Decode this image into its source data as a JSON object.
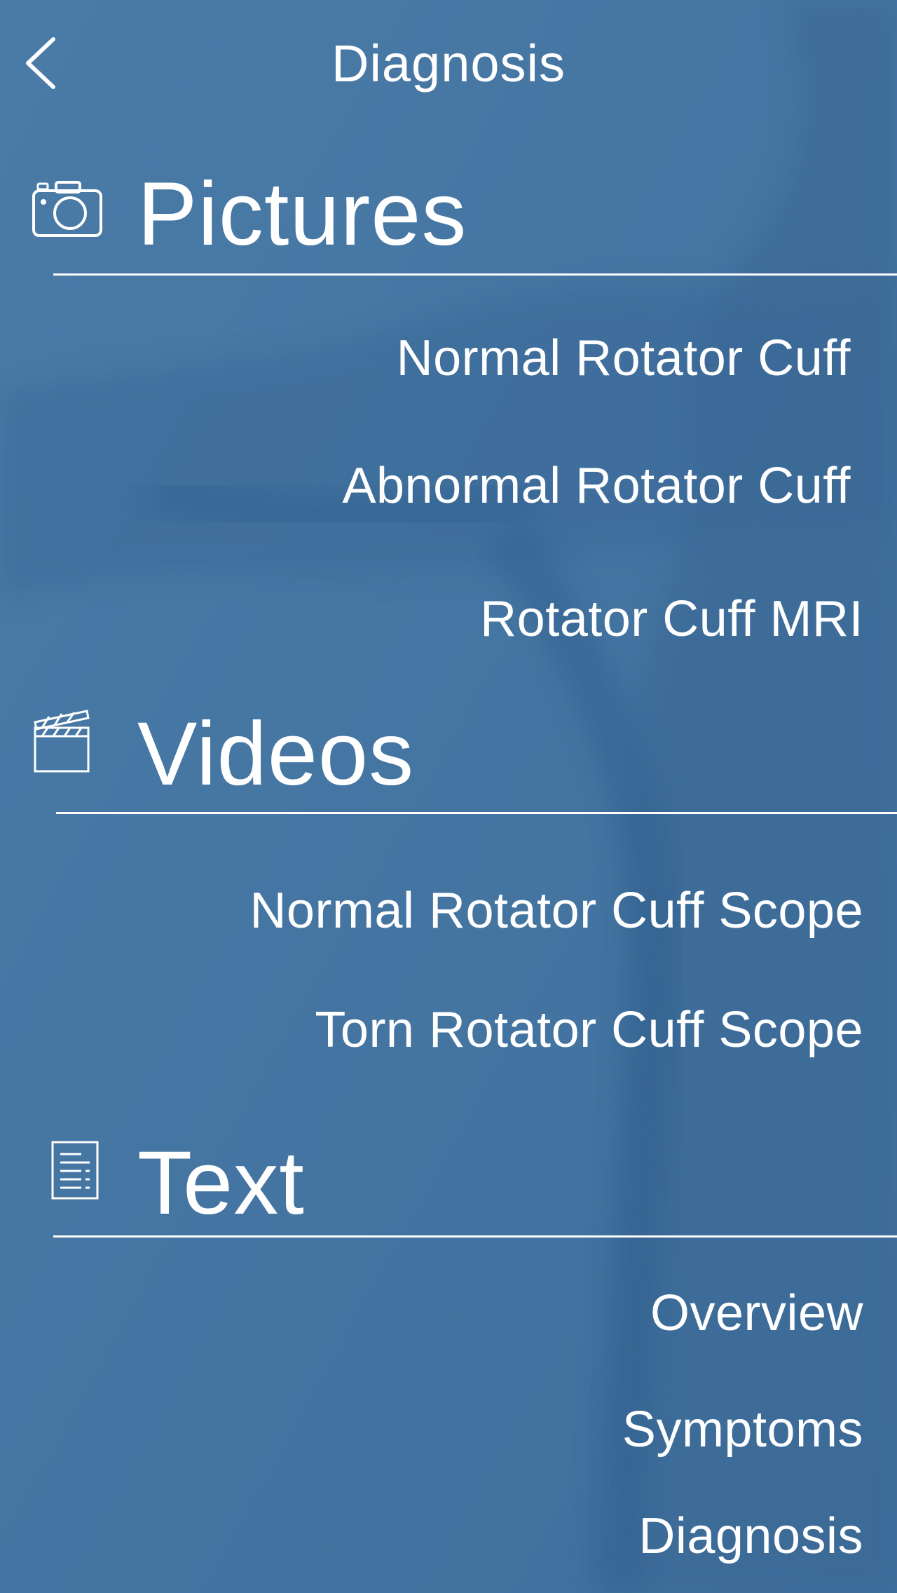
{
  "header": {
    "title": "Diagnosis",
    "back_icon": "chevron-left-icon"
  },
  "sections": [
    {
      "title": "Pictures",
      "icon": "camera-icon",
      "items": [
        {
          "label": "Normal Rotator Cuff"
        },
        {
          "label": "Abnormal Rotator Cuff"
        },
        {
          "label": "Rotator Cuff MRI"
        }
      ]
    },
    {
      "title": "Videos",
      "icon": "clapperboard-icon",
      "items": [
        {
          "label": "Normal Rotator Cuff Scope"
        },
        {
          "label": "Torn Rotator Cuff Scope"
        }
      ]
    },
    {
      "title": "Text",
      "icon": "document-icon",
      "items": [
        {
          "label": "Overview"
        },
        {
          "label": "Symptoms"
        },
        {
          "label": "Diagnosis"
        }
      ]
    }
  ],
  "colors": {
    "background": "#4677a3",
    "shadow": "#2e5d8a",
    "text": "#ffffff"
  }
}
